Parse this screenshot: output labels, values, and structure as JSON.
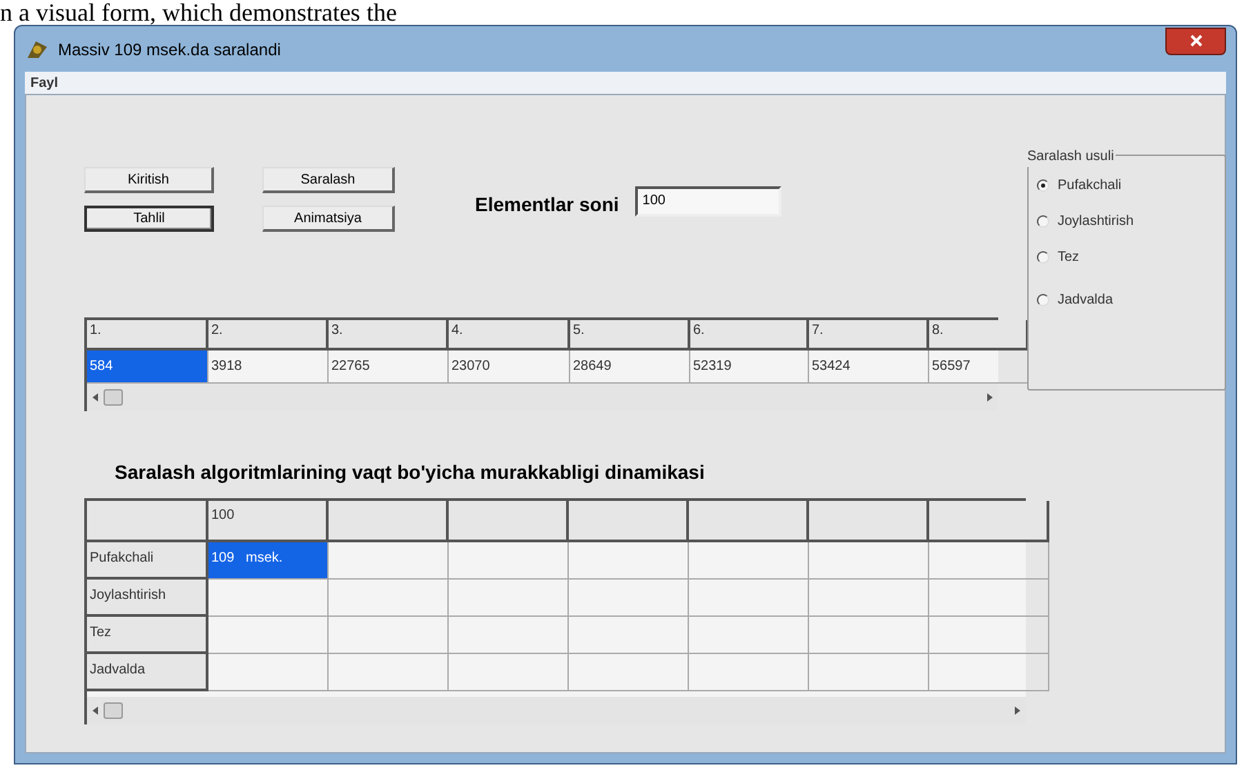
{
  "caption": "n a visual form, which demonstrates the",
  "window": {
    "title": "Massiv  109  msek.da saralandi"
  },
  "menu": [
    "Fayl"
  ],
  "buttons": [
    {
      "label": "Kiritish",
      "default": false
    },
    {
      "label": "Saralash",
      "default": false
    },
    {
      "label": "Tahlil",
      "default": true
    },
    {
      "label": "Animatsiya",
      "default": false
    }
  ],
  "elements_count": {
    "label": "Elementlar soni",
    "value": "100"
  },
  "sort_method": {
    "title": "Saralash usuli",
    "options": [
      {
        "label": "Pufakchali",
        "selected": true
      },
      {
        "label": "Joylashtirish",
        "selected": false
      },
      {
        "label": "Tez",
        "selected": false
      },
      {
        "label": "Jadvalda",
        "selected": false
      }
    ]
  },
  "array_grid": {
    "columns": [
      "1.",
      "2.",
      "3.",
      "4.",
      "5.",
      "6.",
      "7.",
      "8."
    ],
    "cells": [
      {
        "text": "584",
        "selected": true
      },
      {
        "text": "3918",
        "selected": false
      },
      {
        "text": "22765",
        "selected": false
      },
      {
        "text": "23070",
        "selected": false
      },
      {
        "text": "28649",
        "selected": false
      },
      {
        "text": "52319",
        "selected": false
      },
      {
        "text": "53424",
        "selected": false
      },
      {
        "text": "56597",
        "selected": false
      }
    ]
  },
  "chart_title": "Saralash  algoritmlarining  vaqt  bo'yicha  murakkabligi  dinamikasi",
  "time_grid": {
    "columns": [
      "100"
    ],
    "rows": [
      {
        "label": "Pufakchali",
        "cells": [
          {
            "text": "109   msek.",
            "selected": true
          }
        ]
      },
      {
        "label": "Joylashtirish",
        "cells": []
      },
      {
        "label": "Tez",
        "cells": []
      },
      {
        "label": "Jadvalda",
        "cells": []
      }
    ]
  }
}
